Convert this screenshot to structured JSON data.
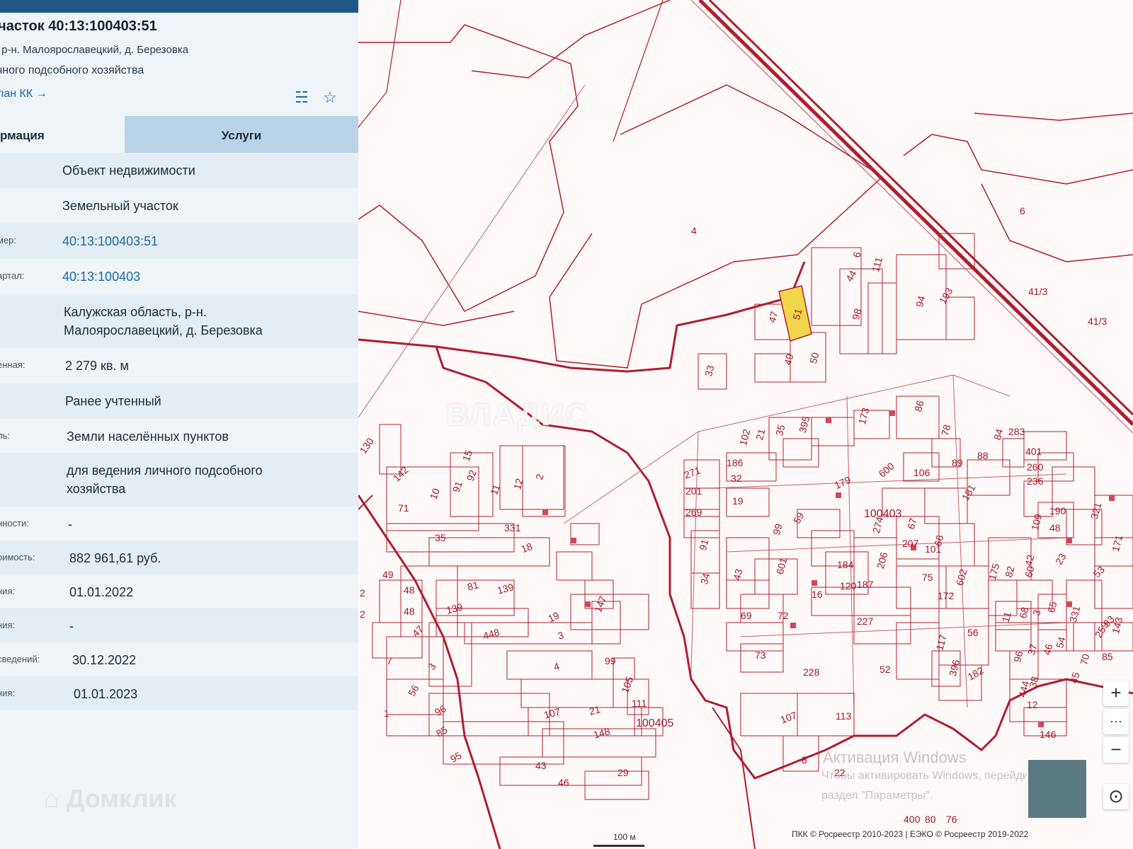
{
  "panel": {
    "title": "участок 40:13:100403:51",
    "address_short": "ь, р-н. Малоярославецкий, д. Березовка",
    "use_short": "ичного подсобного хозяйства",
    "plan_link": "лан КК →",
    "icons": [
      "zoom-to-object-icon",
      "favorite-star-icon"
    ],
    "tabs": {
      "info": "рмация",
      "services": "Услуги"
    },
    "rows": [
      {
        "label": "",
        "value": "Объект недвижимости"
      },
      {
        "label": "",
        "value": "Земельный участок"
      },
      {
        "label": "мер:",
        "value": "40:13:100403:51",
        "link": true
      },
      {
        "label": "артал:",
        "value": "40:13:100403",
        "link": true
      },
      {
        "label": "",
        "value": "Калужская область, р-н.\nМалоярославецкий, д. Березовка"
      },
      {
        "label": "енная:",
        "value": "2 279 кв. м"
      },
      {
        "label": "",
        "value": "Ранее учтенный"
      },
      {
        "label": "ль:",
        "value": "Земли населённых пунктов"
      },
      {
        "label": "",
        "value": "для ведения личного подсобного\nхозяйства"
      },
      {
        "label": "нности:",
        "value": "-"
      },
      {
        "label": "оимость:",
        "value": "882 961,61 руб."
      },
      {
        "label": "ния:",
        "value": "01.01.2022"
      },
      {
        "label": "ния:",
        "value": "-"
      },
      {
        "label": "сведений:",
        "value": "30.12.2022"
      },
      {
        "label": "ния:",
        "value": "01.01.2023"
      }
    ]
  },
  "map": {
    "parcel_numbers": [
      "4",
      "6",
      "41/3",
      "41/3",
      "51",
      "47",
      "49",
      "50",
      "33",
      "44",
      "6",
      "111",
      "98",
      "94",
      "193",
      "130",
      "142",
      "71",
      "10",
      "15",
      "92",
      "91",
      "11",
      "12",
      "2",
      "35",
      "331",
      "18",
      "49",
      "48",
      "48",
      "47",
      "2",
      "2",
      "7",
      "3",
      "56",
      "1",
      "96",
      "85",
      "95",
      "81",
      "139",
      "139",
      "448",
      "19",
      "3",
      "4",
      "147",
      "99",
      "105",
      "111",
      "107",
      "21",
      "148",
      "43",
      "46",
      "29",
      "271",
      "201",
      "269",
      "186",
      "32",
      "19",
      "91",
      "34",
      "43",
      "601",
      "99",
      "59",
      "102",
      "21",
      "35",
      "395",
      "173",
      "86",
      "78",
      "179",
      "600",
      "106",
      "89",
      "88",
      "84",
      "283",
      "401",
      "260",
      "236",
      "181",
      "274",
      "67",
      "184",
      "16",
      "120",
      "187",
      "206",
      "207",
      "101",
      "66",
      "75",
      "172",
      "602",
      "175",
      "82",
      "60",
      "42",
      "23",
      "190",
      "48",
      "109",
      "321",
      "93",
      "69",
      "72",
      "73",
      "228",
      "227",
      "117",
      "56",
      "396",
      "182",
      "52",
      "107",
      "113",
      "8",
      "22",
      "12",
      "146",
      "11",
      "68",
      "3",
      "65",
      "331",
      "259",
      "143",
      "96",
      "37",
      "46",
      "54",
      "70",
      "85",
      "444",
      "38",
      "45",
      "53",
      "171",
      "400",
      "80",
      "76"
    ],
    "block_numbers": [
      "100403",
      "100405"
    ],
    "selected_parcel": "51",
    "colors": {
      "boundary": "#b01e30",
      "thin": "#c8606e",
      "selected": "#f0d64a"
    },
    "scale_label": "100 м",
    "attribution": "ПКК © Росреестр 2010-2023 | ЕЭКО © Росреестр 2019-2022",
    "controls": [
      "zoom-in-icon",
      "more-icon",
      "zoom-out-icon",
      "compass-icon"
    ],
    "control_glyphs": {
      "zoom_in": "+",
      "more": "···",
      "zoom_out": "−",
      "compass": "⊙"
    },
    "watermarks": {
      "vladis": "ВЛАДИС",
      "domclick": "Домклик",
      "windows_1": "Активация Windows",
      "windows_2": "Чтобы активировать Windows, перейдите в",
      "windows_3": "раздел \"Параметры\"."
    }
  }
}
